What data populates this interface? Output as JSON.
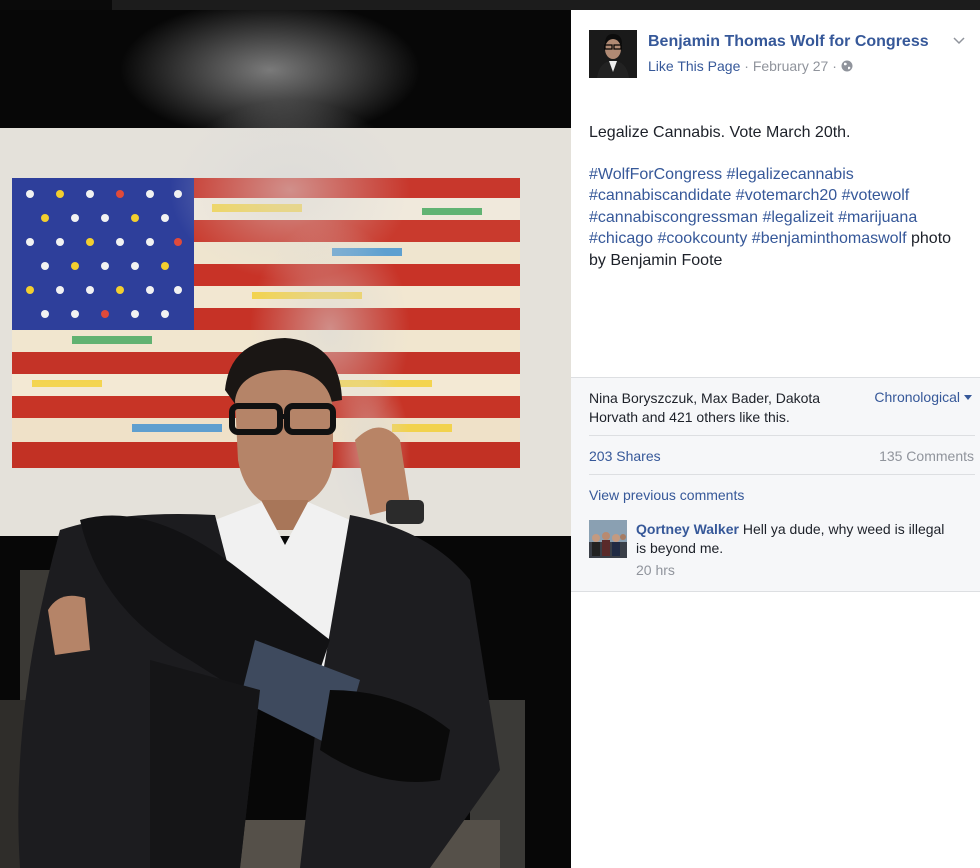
{
  "post": {
    "page_name": "Benjamin Thomas Wolf for Congress",
    "like_link": "Like This Page",
    "separator": "·",
    "date": "February 27",
    "menu_icon": "chevron-down-icon",
    "privacy_icon": "globe-icon",
    "text_line": "Legalize Cannabis. Vote March 20th.",
    "hashtags": {
      "h1": "#WolfForCongress",
      "h2": "#legalizecannabis",
      "h3": "#cannabiscandidate",
      "h4": "#votemarch20",
      "h5": "#votewolf",
      "h6": "#cannabiscongressman",
      "h7": "#legalizeit",
      "h8": "#marijuana",
      "h9": "#chicago",
      "h10": "#cookcounty",
      "h11": "#benjaminthomaswolf"
    },
    "credit": "photo by Benjamin Foote"
  },
  "social": {
    "likes_text": "Nina Boryszczuk, Max Bader, Dakota Horvath and 421 others like this.",
    "sort_label": "Chronological",
    "shares": "203 Shares",
    "comments_count": "135 Comments",
    "view_previous": "View previous comments"
  },
  "comment": {
    "author": "Qortney Walker",
    "text": "Hell ya dude, why weed is illegal is beyond me.",
    "time": "20 hrs"
  },
  "colors": {
    "link": "#365899",
    "meta": "#90949c",
    "text": "#1d2129",
    "panel_bg": "#f6f7f9"
  }
}
